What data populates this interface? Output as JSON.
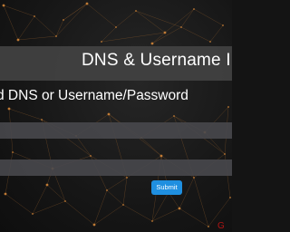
{
  "banner": {
    "title": "DNS & Username Inp"
  },
  "form": {
    "instruction": "d DNS or Username/Password",
    "dns_field": {
      "value": "",
      "placeholder": ""
    },
    "username_field": {
      "value": "",
      "placeholder": ""
    },
    "submit_label": "Submit"
  },
  "background": {
    "style": "network-constellation",
    "line_color": "#8a5a2a",
    "node_color": "#d98a3a"
  },
  "colors": {
    "accent": "#1f8fe0",
    "banner": "#424242",
    "field": "#48484c",
    "corner_mark": "#b01414"
  },
  "corner_mark": {
    "icon": "partial-glyph-icon",
    "text": "G"
  }
}
